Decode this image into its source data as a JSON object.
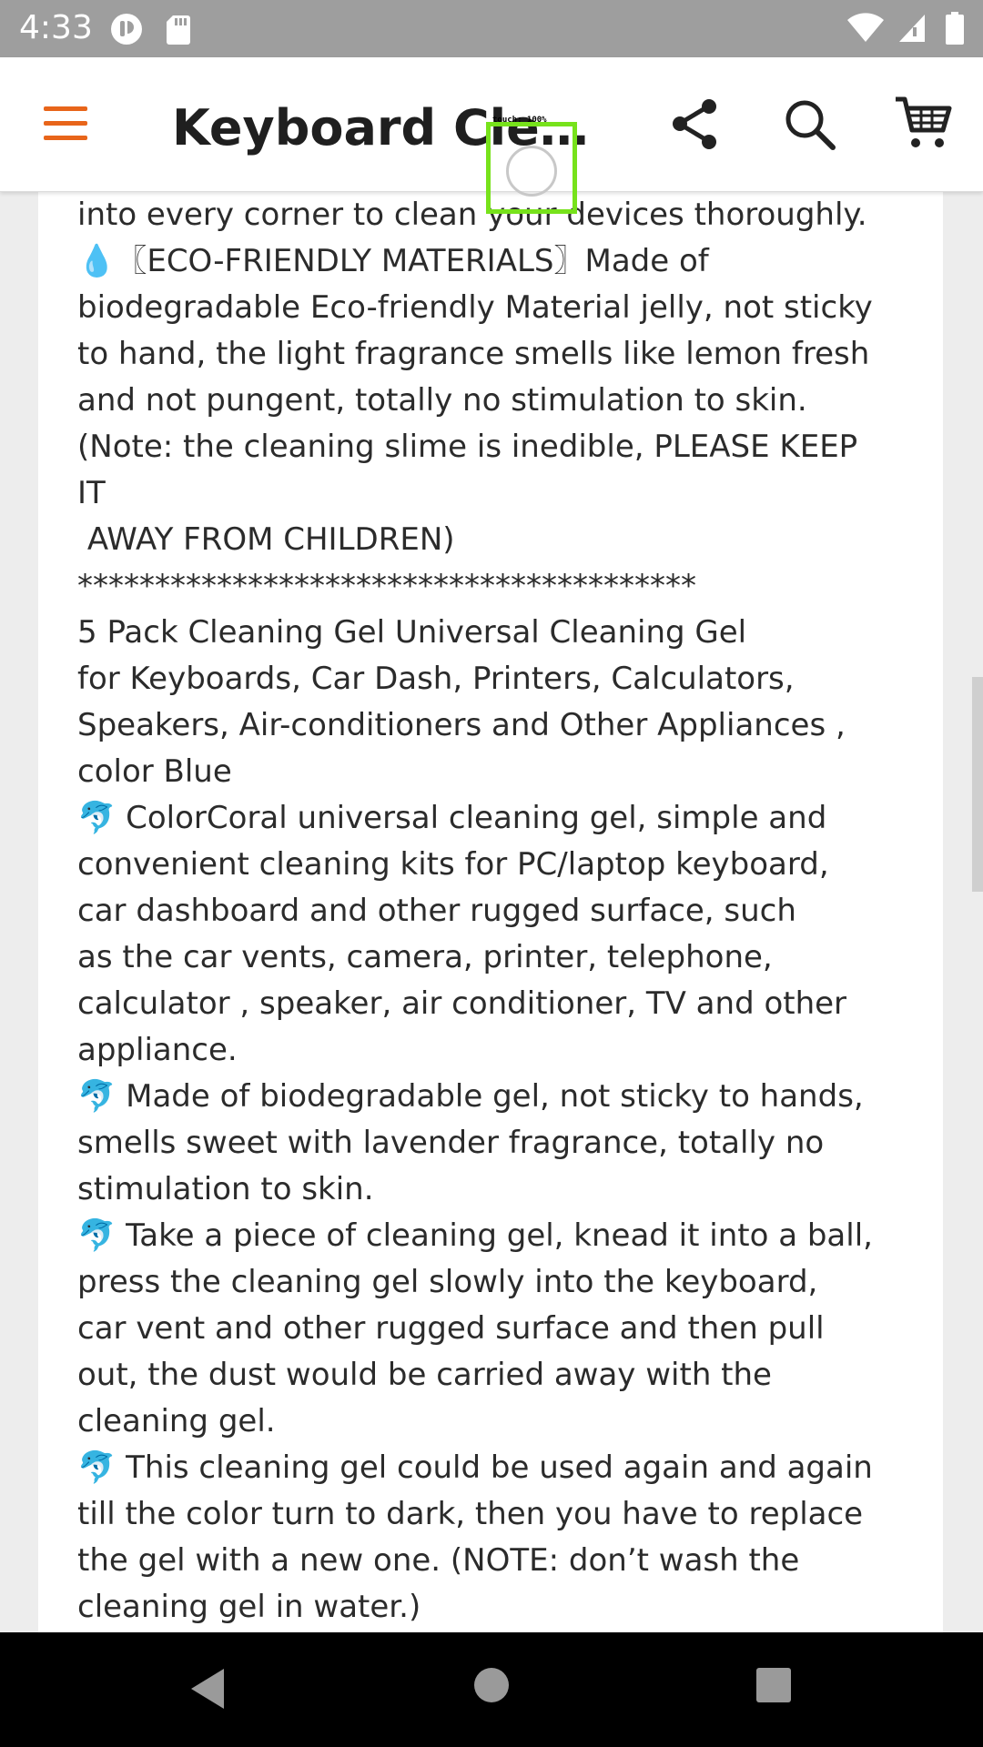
{
  "status_bar": {
    "time": "4:33",
    "icons": [
      "notification-circle-icon",
      "sd-card-icon",
      "wifi-icon",
      "cell-signal-icon",
      "battery-icon"
    ]
  },
  "app_bar": {
    "title": "Keyboard Cleaner",
    "icons": [
      "menu-icon",
      "share-icon",
      "search-icon",
      "cart-icon"
    ],
    "accent_color": "#e8651a"
  },
  "description": {
    "text": "car vents, it can reach spots and gaps, penetrate\ninto every corner to clean your devices thoroughly.\n💧〖ECO-FRIENDLY MATERIALS〗Made of\nbiodegradable Eco-friendly Material jelly, not sticky\nto hand, the light fragrance smells like lemon fresh\nand not pungent, totally no stimulation to skin.\n(Note: the cleaning slime is inedible, PLEASE KEEP\nIT\n AWAY FROM CHILDREN)\n****************************************\n5 Pack Cleaning Gel Universal Cleaning Gel\nfor Keyboards, Car Dash, Printers, Calculators,\nSpeakers, Air-conditioners and Other Appliances ,\ncolor Blue\n🐬 ColorCoral universal cleaning gel, simple and\nconvenient cleaning kits for PC/laptop keyboard,\ncar dashboard and other rugged surface, such\nas the car vents, camera, printer, telephone,\ncalculator , speaker, air conditioner, TV and other\nappliance.\n🐬 Made of biodegradable gel, not sticky to hands,\nsmells sweet with lavender fragrance, totally no\nstimulation to skin.\n🐬 Take a piece of cleaning gel, knead it into a ball,\npress the cleaning gel slowly into the keyboard,\ncar vent and other rugged surface and then pull\nout, the dust would be carried away with the\ncleaning gel.\n🐬 This cleaning gel could be used again and again\ntill the color turn to dark, then you have to replace\nthe gel with a new one. (NOTE: don’t wash the\ncleaning gel in water.)"
  },
  "touch_indicator": {
    "label": "touch: 100%"
  },
  "nav_bar": {
    "icons": [
      "back-icon",
      "home-icon",
      "recents-icon"
    ]
  }
}
